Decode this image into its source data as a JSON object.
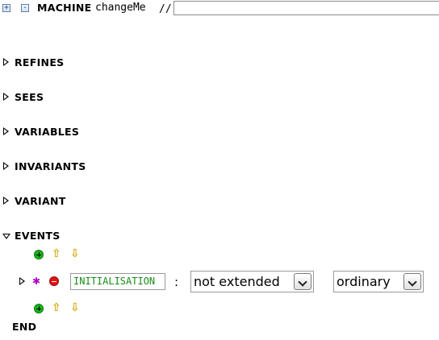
{
  "header": {
    "keyword": "MACHINE",
    "machine_name": "changeMe",
    "comment_marker": "//",
    "comment_value": ""
  },
  "sections": {
    "refines": "REFINES",
    "sees": "SEES",
    "variables": "VARIABLES",
    "invariants": "INVARIANTS",
    "variant": "VARIANT",
    "events": "EVENTS"
  },
  "event": {
    "name": "INITIALISATION",
    "separator": ":",
    "extended": "not extended",
    "convergence": "ordinary"
  },
  "footer": {
    "end": "END"
  },
  "icons": {
    "expand": "expand-all-icon",
    "collapse": "collapse-all-icon",
    "add": "add-icon",
    "move_up": "move-up-icon",
    "move_down": "move-down-icon",
    "remove": "remove-icon",
    "event_star": "event-star-icon"
  },
  "colors": {
    "event_label": "#1a8c1a",
    "add_icon": "#19b419",
    "remove_icon": "#e01212",
    "arrow_icon": "#d6a700",
    "star_icon": "#b000c8"
  }
}
